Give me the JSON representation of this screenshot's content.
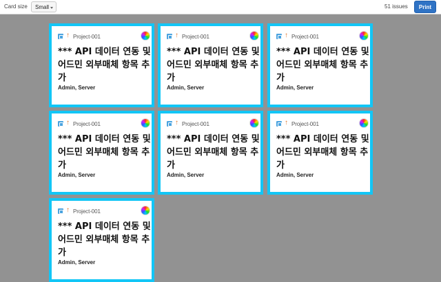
{
  "toolbar": {
    "card_size_label": "Card size",
    "card_size_value": "Small",
    "issue_count": "51 issues",
    "print_label": "Print"
  },
  "cards": [
    {
      "key": "Project-001",
      "title": "*** API 데이터 연동 및 어드민 외부매체 항목 추가",
      "components": "Admin, Server"
    },
    {
      "key": "Project-001",
      "title": "*** API 데이터 연동 및 어드민 외부매체 항목 추가",
      "components": "Admin, Server"
    },
    {
      "key": "Project-001",
      "title": "*** API 데이터 연동 및 어드민 외부매체 항목 추가",
      "components": "Admin, Server"
    },
    {
      "key": "Project-001",
      "title": "*** API 데이터 연동 및 어드민 외부매체 항목 추가",
      "components": "Admin, Server"
    },
    {
      "key": "Project-001",
      "title": "*** API 데이터 연동 및 어드민 외부매체 항목 추가",
      "components": "Admin, Server"
    },
    {
      "key": "Project-001",
      "title": "*** API 데이터 연동 및 어드민 외부매체 항목 추가",
      "components": "Admin, Server"
    },
    {
      "key": "Project-001",
      "title": "*** API 데이터 연동 및 어드민 외부매체 항목 추가",
      "components": "Admin, Server"
    }
  ],
  "colors": {
    "card_border": "#12c6f6",
    "print_button": "#2f73c5",
    "background": "#929292"
  },
  "icons": {
    "issue_type": "story-icon",
    "priority": "arrow-up-icon",
    "assignee": "avatar"
  }
}
